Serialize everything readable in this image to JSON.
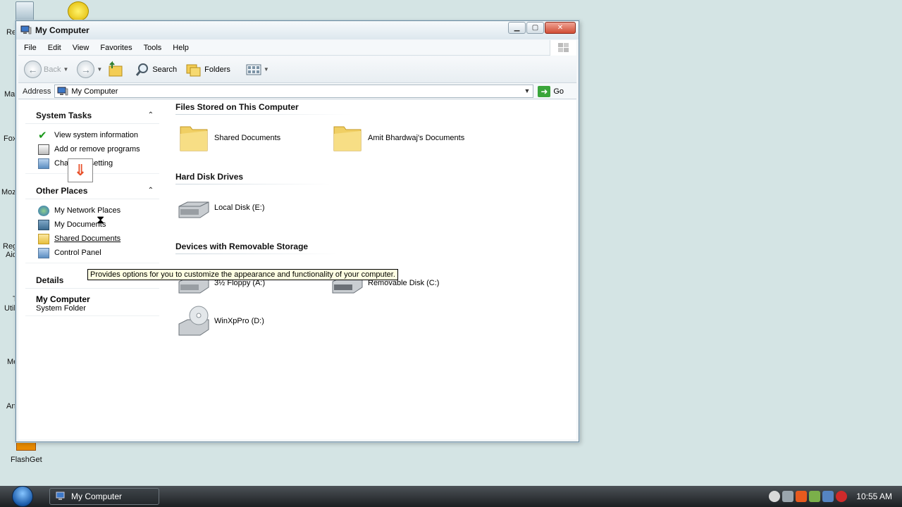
{
  "desktop": {
    "partial_labels": [
      "Re",
      "Mai",
      "Fox",
      "Moz",
      "Reg",
      "Aid",
      "T",
      "Util",
      "Me",
      "An"
    ],
    "flashget_label": "FlashGet"
  },
  "window": {
    "title": "My Computer",
    "menu": [
      "File",
      "Edit",
      "View",
      "Favorites",
      "Tools",
      "Help"
    ],
    "toolbar": {
      "back": "Back",
      "search": "Search",
      "folders": "Folders"
    },
    "address": {
      "label": "Address",
      "value": "My Computer",
      "go": "Go"
    }
  },
  "taskpane": {
    "system_tasks": {
      "title": "System Tasks",
      "items": [
        "View system information",
        "Add or remove programs",
        "Change a setting"
      ]
    },
    "other_places": {
      "title": "Other Places",
      "items": [
        "My Network Places",
        "My Documents",
        "Shared Documents",
        "Control Panel"
      ]
    },
    "details": {
      "title": "Details",
      "name": "My Computer",
      "type": "System Folder"
    }
  },
  "groups": {
    "files_stored": {
      "title": "Files Stored on This Computer",
      "items": [
        "Shared Documents",
        "Amit Bhardwaj's Documents"
      ]
    },
    "hard_disks": {
      "title": "Hard Disk Drives",
      "items": [
        "Local Disk (E:)"
      ]
    },
    "removable": {
      "title": "Devices with Removable Storage",
      "items": [
        "3½ Floppy (A:)",
        "Removable Disk (C:)",
        "WinXpPro (D:)"
      ]
    }
  },
  "tooltip": "Provides options for you to customize the appearance and functionality of your computer.",
  "taskbar": {
    "task_label": "My Computer",
    "clock": "10:55 AM"
  },
  "colors": {
    "desktop": "#d4e4e4",
    "tooltip_bg": "#ffffe1",
    "taskbar": "#1c1f22"
  }
}
